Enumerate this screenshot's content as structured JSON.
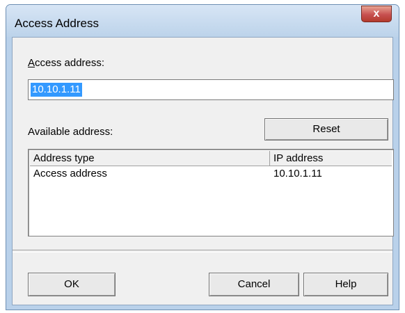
{
  "window": {
    "title": "Access Address",
    "close_label": "x"
  },
  "access": {
    "label": "ccess address:",
    "label_mnemonic": "A",
    "value": "10.10.1.11"
  },
  "available": {
    "label": "Available address:",
    "reset_label": "Reset"
  },
  "table": {
    "columns": [
      "Address type",
      "IP address"
    ],
    "rows": [
      {
        "type": "Access address",
        "ip": "10.10.1.11"
      }
    ]
  },
  "buttons": {
    "ok": "OK",
    "cancel": "Cancel",
    "help": "Help"
  }
}
